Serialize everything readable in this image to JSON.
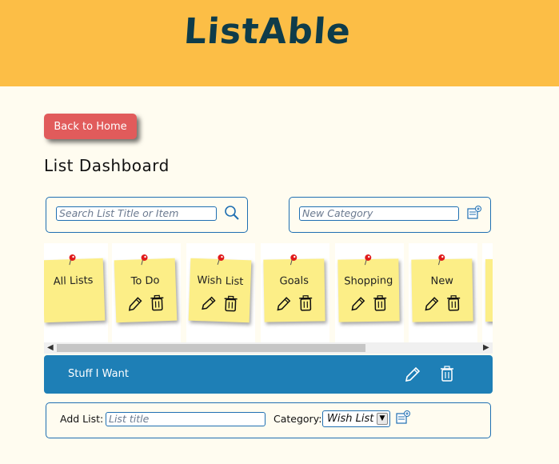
{
  "app": {
    "title": "ListAble"
  },
  "nav": {
    "back_label": "Back to Home"
  },
  "dashboard": {
    "title": "List Dashboard"
  },
  "search": {
    "placeholder": "Search List Title or Item"
  },
  "new_category": {
    "placeholder": "New Category"
  },
  "categories": [
    {
      "label": "All Lists",
      "actions": false
    },
    {
      "label": "To Do",
      "actions": true
    },
    {
      "label": "Wish List",
      "actions": true
    },
    {
      "label": "Goals",
      "actions": true
    },
    {
      "label": "Shopping",
      "actions": true
    },
    {
      "label": "New",
      "actions": true
    }
  ],
  "selected_list": {
    "label": "Stuff I Want"
  },
  "add_list": {
    "label": "Add List:",
    "title_placeholder": "List title",
    "category_label": "Category:",
    "category_value": "Wish List"
  },
  "colors": {
    "header": "#fcbe46",
    "accent_blue": "#1e7fb6",
    "back_button": "#e15b5b",
    "note": "#fcee87"
  }
}
